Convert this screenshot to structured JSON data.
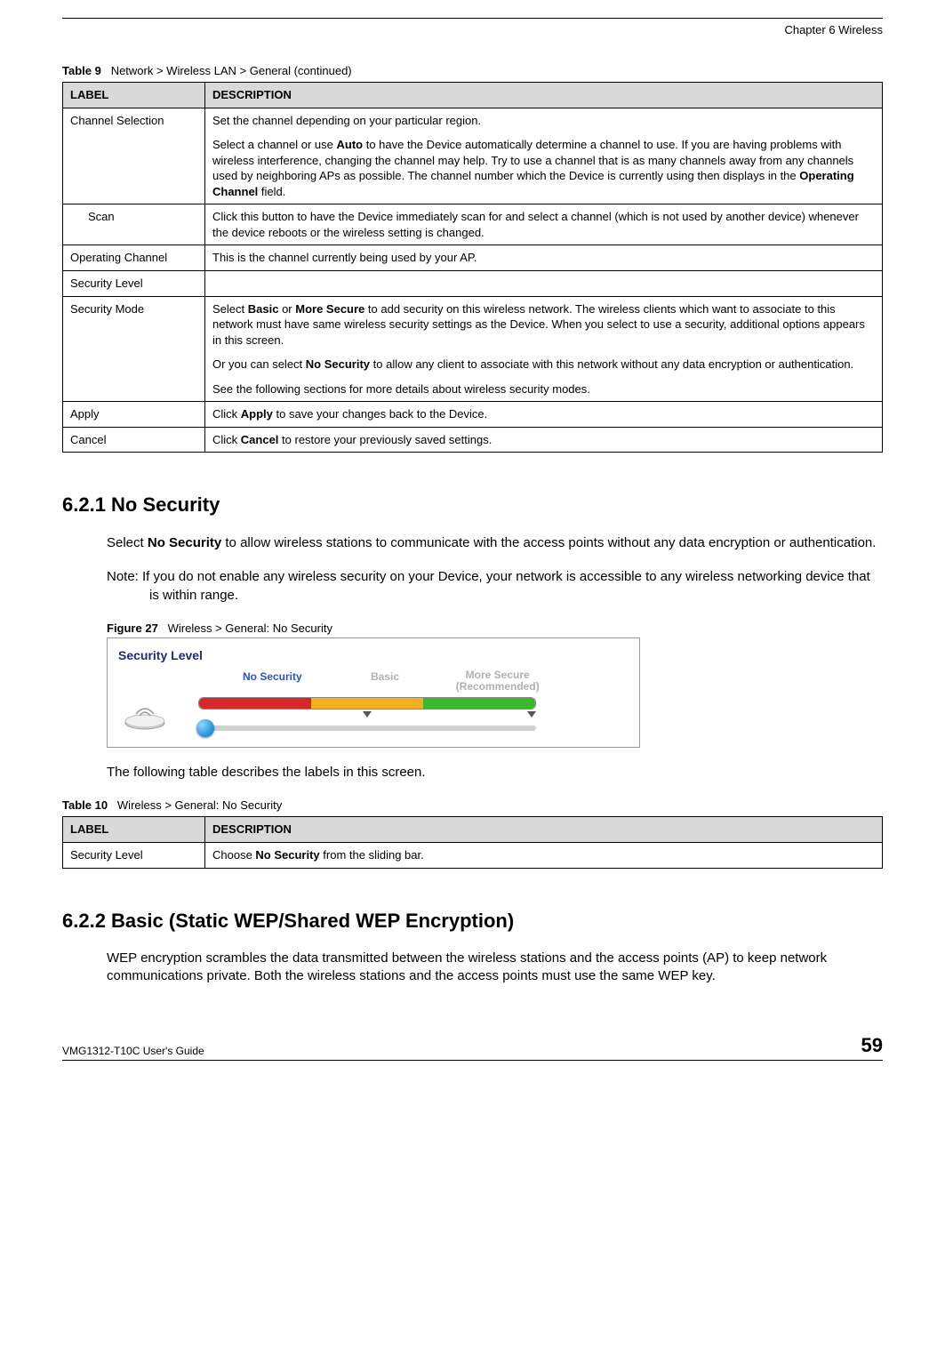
{
  "chapter": "Chapter 6 Wireless",
  "table9": {
    "caption_num": "Table 9",
    "caption_text": "Network > Wireless LAN > General (continued)",
    "head_label": "LABEL",
    "head_desc": "DESCRIPTION",
    "rows": {
      "channel_selection": {
        "label": "Channel Selection",
        "p1": "Set the channel depending on your particular region.",
        "p2a": "Select a channel or use ",
        "p2b": "Auto",
        "p2c": " to have the Device automatically determine a channel to use. If you are having problems with wireless interference, changing the channel may help. Try to use a channel that is as many channels away from any channels used by neighboring APs as possible. The channel number which the Device is currently using then displays in the ",
        "p2d": "Operating Channel",
        "p2e": " field."
      },
      "scan": {
        "label": "Scan",
        "desc": "Click this button to have the Device immediately scan for and select a channel (which is not used by another device) whenever the device reboots or the wireless setting is changed."
      },
      "operating_channel": {
        "label": "Operating Channel",
        "desc": "This is the channel currently being used by your AP."
      },
      "security_level": {
        "label": "Security Level",
        "desc": ""
      },
      "security_mode": {
        "label": "Security Mode",
        "p1a": "Select ",
        "p1b": "Basic",
        "p1c": " or ",
        "p1d": "More Secure",
        "p1e": " to add security on this wireless network. The wireless clients which want to associate to this network must have same wireless security settings as the Device. When you select to use a security, additional options appears in this screen.",
        "p2a": "Or you can select ",
        "p2b": "No Security",
        "p2c": " to allow any client to associate with this network without any data encryption or authentication.",
        "p3": "See the following sections for more details about wireless security modes."
      },
      "apply": {
        "label": "Apply",
        "d1": "Click ",
        "d2": "Apply",
        "d3": " to save your changes back to the Device."
      },
      "cancel": {
        "label": "Cancel",
        "d1": "Click ",
        "d2": "Cancel",
        "d3": " to restore your previously saved settings."
      }
    }
  },
  "sec621": {
    "heading": "6.2.1  No Security",
    "p1a": "Select ",
    "p1b": "No Security",
    "p1c": " to allow wireless stations to communicate with the access points without any data encryption or authentication.",
    "note": "Note: If you do not enable any wireless security on your Device, your network is accessible to any wireless networking device that is within range."
  },
  "figure27": {
    "caption_num": "Figure 27",
    "caption_text": "Wireless > General: No Security",
    "panel_title": "Security Level",
    "lbl_no": "No Security",
    "lbl_basic": "Basic",
    "lbl_more_line1": "More Secure",
    "lbl_more_line2": "(Recommended)"
  },
  "post_figure": "The following table describes the labels in this screen.",
  "table10": {
    "caption_num": "Table 10",
    "caption_text": "Wireless > General: No Security",
    "head_label": "LABEL",
    "head_desc": "DESCRIPTION",
    "row": {
      "label": "Security Level",
      "d1": "Choose ",
      "d2": "No Security",
      "d3": " from the sliding bar."
    }
  },
  "sec622": {
    "heading": "6.2.2  Basic (Static WEP/Shared WEP Encryption)",
    "p1": "WEP encryption scrambles the data transmitted between the wireless stations and the access points (AP) to keep network communications private. Both the wireless stations and the access points must use the same WEP key."
  },
  "footer": {
    "guide": "VMG1312-T10C User's Guide",
    "page": "59"
  }
}
